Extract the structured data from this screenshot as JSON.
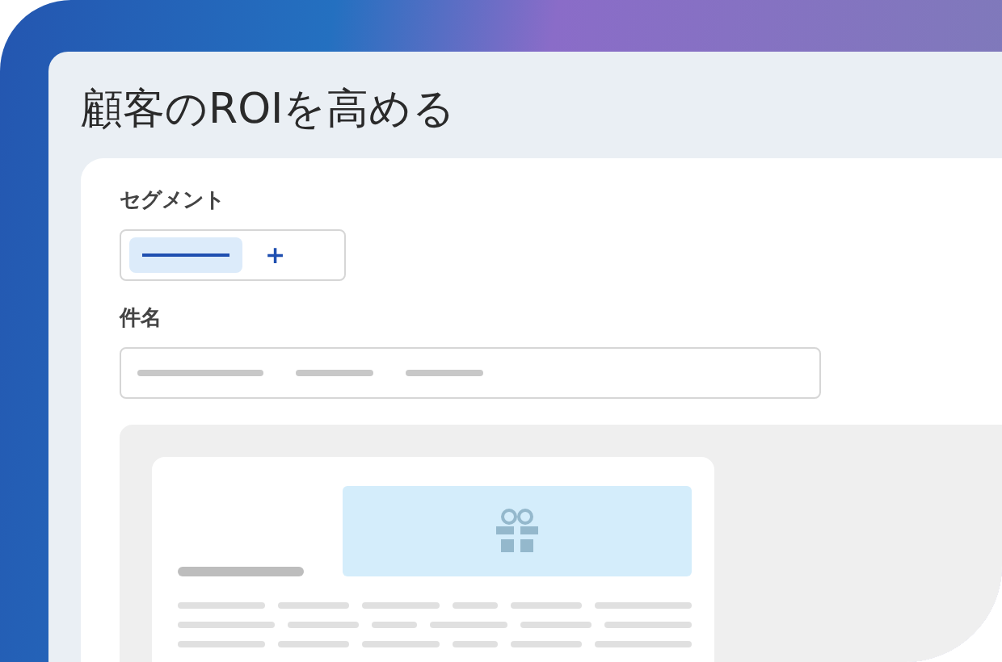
{
  "title": "顧客のROIを高める",
  "segment": {
    "label": "セグメント",
    "add": "+"
  },
  "subject": {
    "label": "件名"
  }
}
